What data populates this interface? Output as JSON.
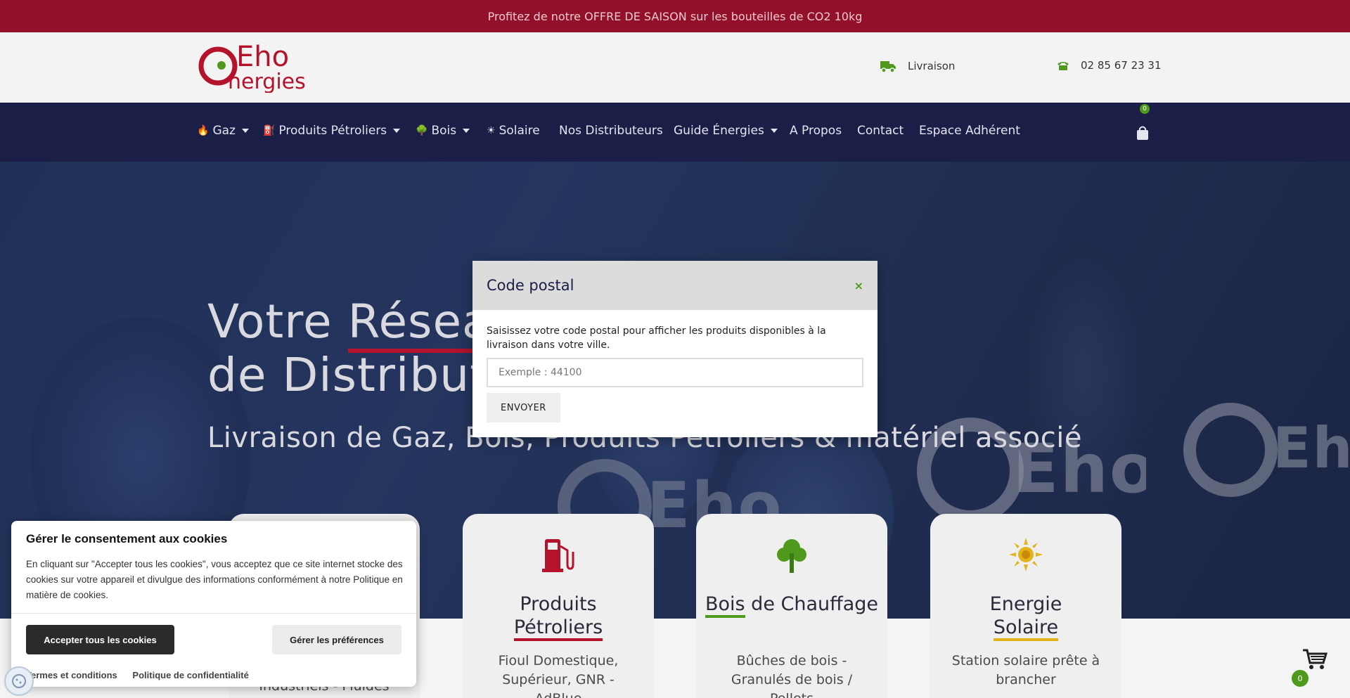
{
  "announcement": "Profitez de notre OFFRE DE SAISON sur les bouteilles de CO2 10kg",
  "brand": {
    "logo_text_top": "Eho",
    "logo_text_bottom": "nergies",
    "colors": {
      "red": "#b5122b",
      "navy": "#1b1e47",
      "green": "#4f9a1d"
    }
  },
  "header": {
    "delivery_label": "Livraison",
    "delivery_icon": "truck-icon",
    "phone": "02 85 67 23 31",
    "phone_icon": "phone-icon"
  },
  "nav": {
    "items": [
      {
        "label": "Gaz",
        "icon": "flame-icon",
        "dropdown": true
      },
      {
        "label": "Produits Pétroliers",
        "icon": "fuel-pump-icon",
        "dropdown": true
      },
      {
        "label": "Bois",
        "icon": "tree-icon",
        "dropdown": true
      },
      {
        "label": "Solaire",
        "icon": "sun-icon",
        "dropdown": false
      },
      {
        "label": "Nos Distributeurs",
        "dropdown": false
      },
      {
        "label": "Guide Énergies",
        "dropdown": true
      },
      {
        "label": "A Propos",
        "dropdown": false
      },
      {
        "label": "Contact",
        "dropdown": false
      },
      {
        "label": "Espace Adhérent",
        "dropdown": false
      }
    ],
    "cart_count": "0"
  },
  "hero": {
    "title_part1": "Votre ",
    "title_highlight": "Résea",
    "title_line2": "de Distribute",
    "subtitle": "Livraison de Gaz, Bois, Produits Pétroliers & matériel associé"
  },
  "cards": [
    {
      "title_a": "",
      "title_b": "",
      "desc": "Industriels - Fluides"
    },
    {
      "title_a": "Produits",
      "title_b": "Pétroliers",
      "desc": "Fioul Domestique, Supérieur, GNR - AdBlue",
      "icon": "fuel-pump-icon"
    },
    {
      "title_a": "Bois",
      "title_b": " de Chauffage",
      "desc": "Bûches de bois - Granulés de bois / Pellets",
      "icon": "tree-icon"
    },
    {
      "title_a": "Energie",
      "title_b": "Solaire",
      "desc": "Station solaire prête à brancher",
      "icon": "sun-icon"
    }
  ],
  "modal": {
    "title": "Code postal",
    "close": "×",
    "text": "Saisissez votre code postal pour afficher les produits disponibles à la livraison dans votre ville.",
    "placeholder": "Exemple : 44100",
    "submit": "ENVOYER"
  },
  "cookie": {
    "title": "Gérer le consentement aux cookies",
    "text": "En cliquant sur \"Accepter tous les cookies\", vous acceptez que ce site internet stocke des cookies sur votre appareil et divulgue des informations conformément à notre Politique en matière de cookies.",
    "accept": "Accepter tous les cookies",
    "preferences": "Gérer les préférences",
    "link_terms": "Termes et conditions",
    "link_privacy": "Politique de confidentialité"
  },
  "floating_cart_count": "0"
}
